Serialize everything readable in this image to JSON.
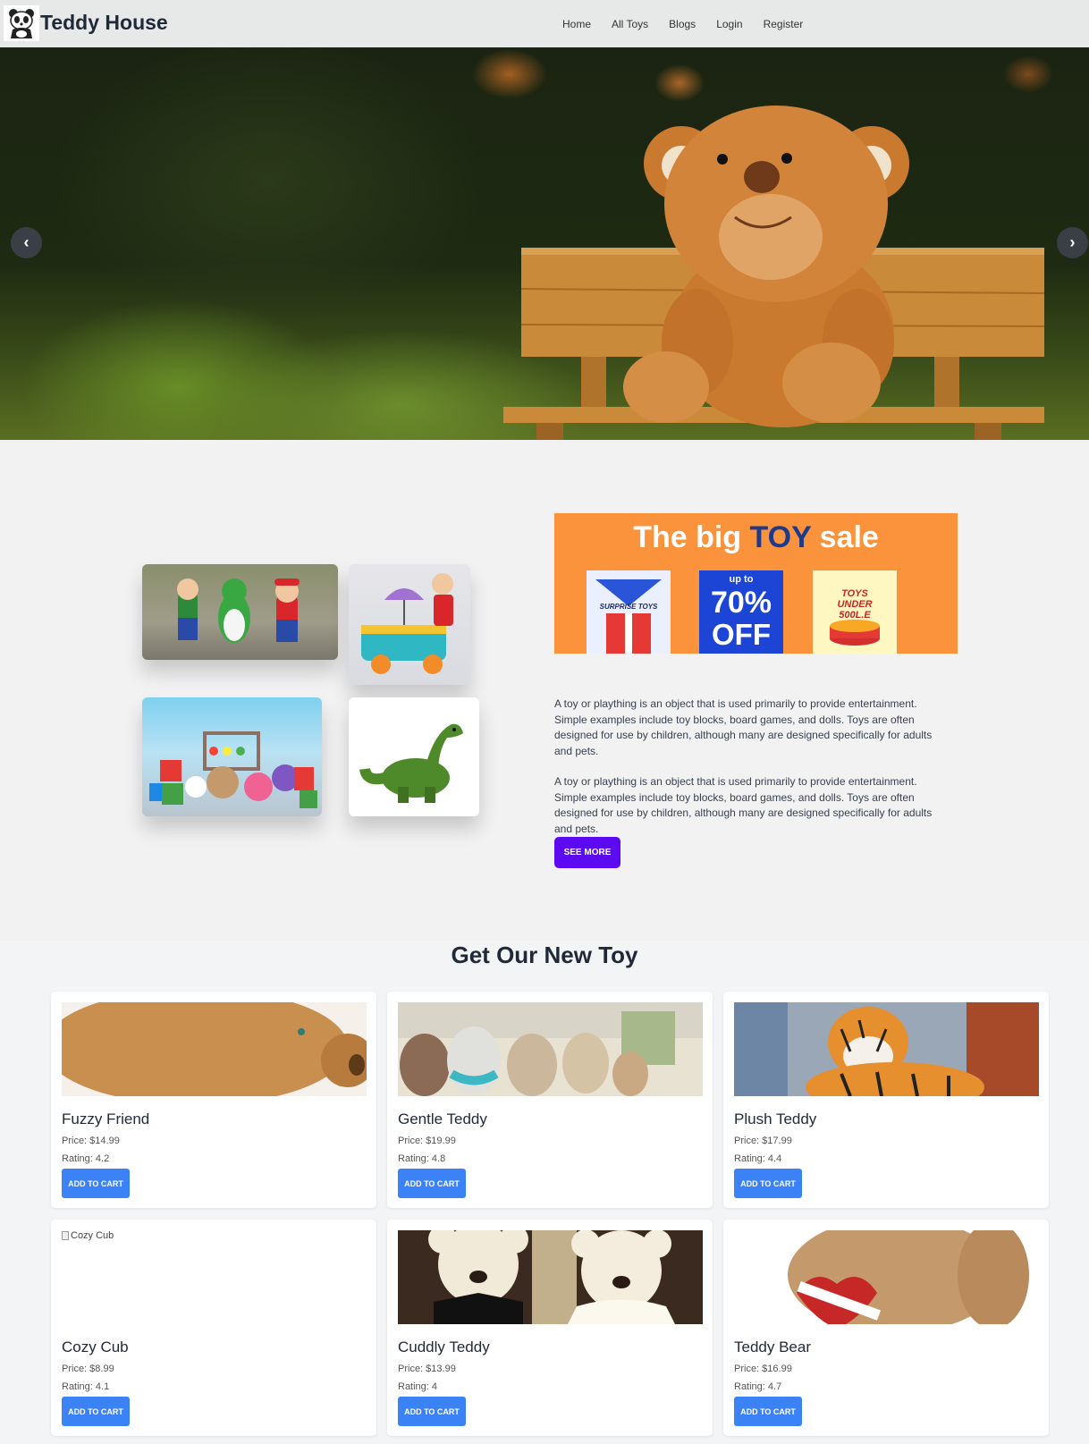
{
  "navbar": {
    "brand": "Teddy House",
    "logo_icon": "panda-icon",
    "links": [
      "Home",
      "All Toys",
      "Blogs",
      "Login",
      "Register"
    ]
  },
  "hero": {
    "prev_symbol": "‹",
    "next_symbol": "›"
  },
  "about": {
    "sale_title_prefix": "The big ",
    "sale_title_highlight": "TOY",
    "sale_title_suffix": " sale",
    "sale_cards": {
      "surprise": "SURPRISE TOYS",
      "discount_top": "up to",
      "discount_value": "70%",
      "discount_bottom": "OFF",
      "under_price": "TOYS UNDER 500L.E"
    },
    "paragraph_1": "A toy or plaything is an object that is used primarily to provide entertainment. Simple examples include toy blocks, board games, and dolls. Toys are often designed for use by children, although many are designed specifically for adults and pets.",
    "paragraph_2": "A toy or plaything is an object that is used primarily to provide entertainment. Simple examples include toy blocks, board games, and dolls. Toys are often designed for use by children, although many are designed specifically for adults and pets.",
    "see_more_label": "SEE MORE"
  },
  "new_toys": {
    "title": "Get Our New Toy",
    "cart_label": "ADD TO CART",
    "items": [
      {
        "name": "Fuzzy Friend",
        "price": "Price: $14.99",
        "rating": "Rating: 4.2"
      },
      {
        "name": "Gentle Teddy",
        "price": "Price: $19.99",
        "rating": "Rating: 4.8"
      },
      {
        "name": "Plush Teddy",
        "price": "Price: $17.99",
        "rating": "Rating: 4.4"
      },
      {
        "name": "Cozy Cub",
        "price": "Price: $8.99",
        "rating": "Rating: 4.1",
        "image_alt": "Cozy Cub"
      },
      {
        "name": "Cuddly Teddy",
        "price": "Price: $13.99",
        "rating": "Rating: 4"
      },
      {
        "name": "Teddy Bear",
        "price": "Price: $16.99",
        "rating": "Rating: 4.7"
      }
    ]
  },
  "colors": {
    "navbar_bg": "#e7e8e8",
    "sale_orange": "#fb923c",
    "see_more_purple": "#5b0af2",
    "cart_blue": "#3b82f6"
  }
}
